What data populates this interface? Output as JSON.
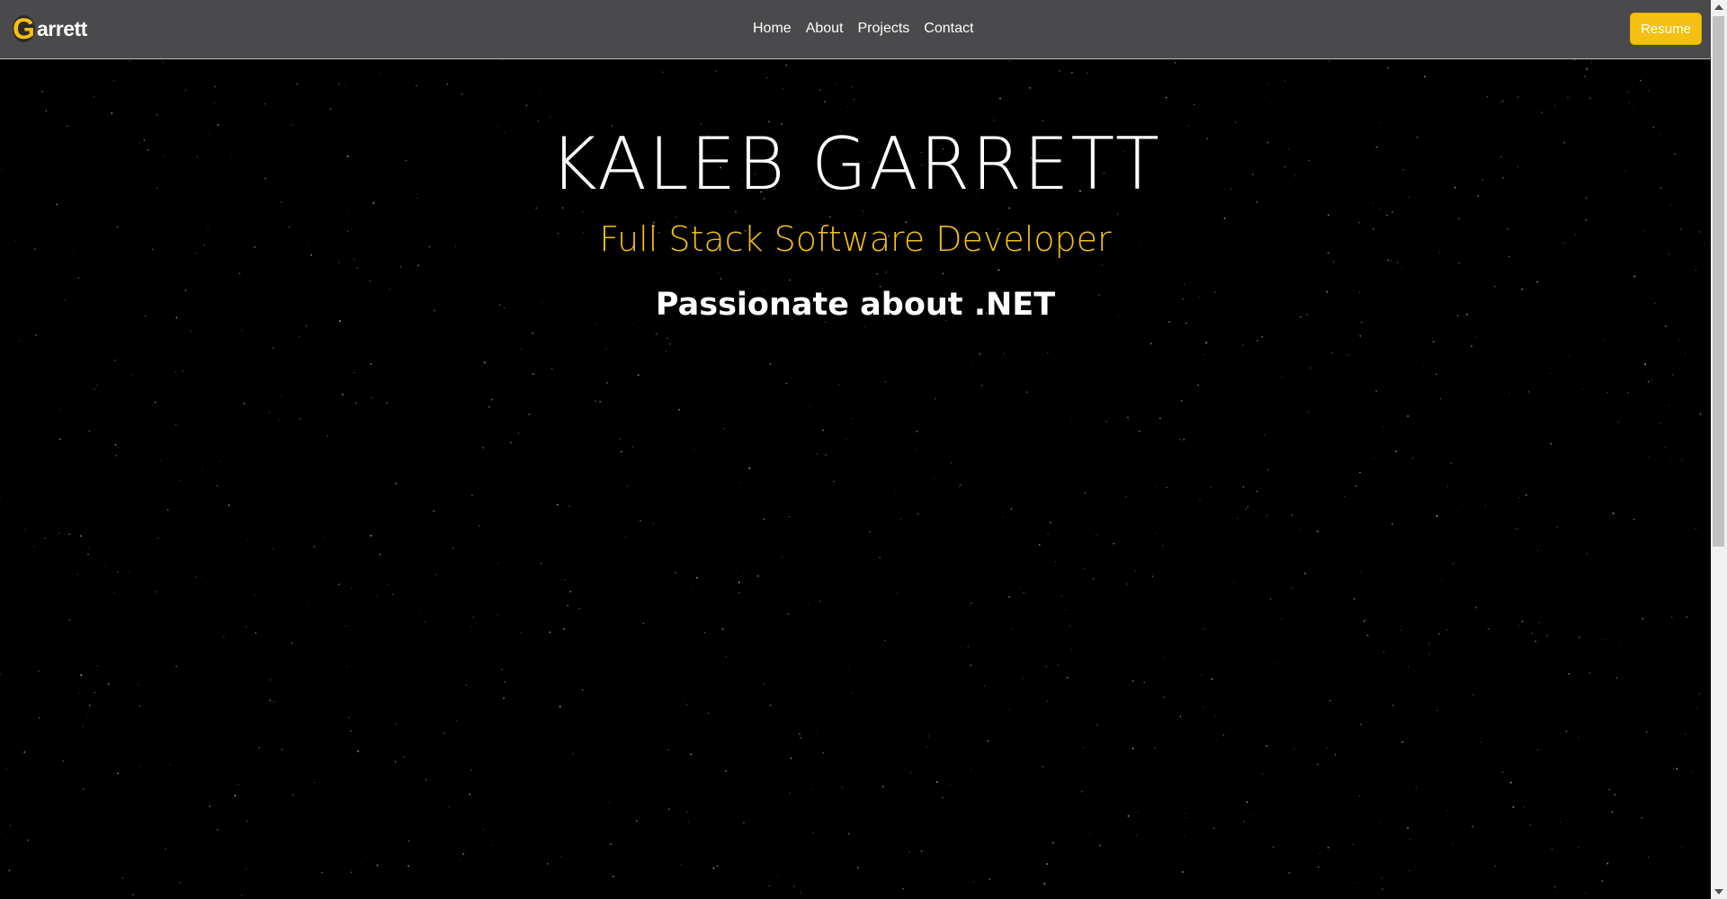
{
  "navbar": {
    "brand_initial": "G",
    "brand_rest": "arrett",
    "links": [
      {
        "label": "Home"
      },
      {
        "label": "About"
      },
      {
        "label": "Projects"
      },
      {
        "label": "Contact"
      }
    ],
    "resume_label": "Resume"
  },
  "hero": {
    "title": "KALEB GARRETT",
    "subtitle": "Full Stack Software Developer",
    "tagline": "Passionate about .NET"
  },
  "colors": {
    "accent": "#f5c012",
    "navbar_bg": "#4a494b",
    "background": "#000000",
    "text": "#ffffff"
  },
  "icons": {
    "scroll_up": "chevron-up-icon",
    "scroll_down": "chevron-down-icon"
  }
}
